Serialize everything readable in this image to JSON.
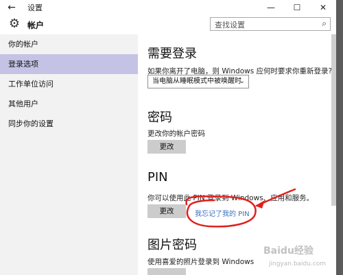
{
  "titlebar": {
    "back_icon": "←",
    "title": "设置",
    "minimize": "—",
    "maximize": "☐",
    "close": "✕"
  },
  "header": {
    "gear_icon": "⚙",
    "section": "帐户",
    "search_placeholder": "查找设置",
    "search_icon": "⌕"
  },
  "sidebar": {
    "items": [
      {
        "label": "你的帐户"
      },
      {
        "label": "登录选项"
      },
      {
        "label": "工作单位访问"
      },
      {
        "label": "其他用户"
      },
      {
        "label": "同步你的设置"
      }
    ],
    "selected_index": 1
  },
  "require_signin": {
    "heading": "需要登录",
    "description": "如果你离开了电脑，则 Windows 应何时要求你重新登录?",
    "dropdown_value": "当电脑从睡眠模式中被唤醒时",
    "dropdown_icon": "⌄"
  },
  "password": {
    "heading": "密码",
    "description": "更改你的帐户密码",
    "button": "更改"
  },
  "pin": {
    "heading": "PIN",
    "description": "你可以使用此 PIN 登录到 Windows、应用和服务。",
    "button": "更改",
    "link": "我忘记了我的 PIN"
  },
  "picture_password": {
    "heading": "图片密码",
    "description": "使用喜爱的照片登录到 Windows"
  },
  "watermark": {
    "logo": "Baidu经验",
    "url": "jingyan.baidu.com"
  },
  "colors": {
    "selected_bg": "#c4c3e6",
    "sidebar_bg": "#f2f2f2",
    "button_bg": "#cccccc",
    "link": "#3c6fc0",
    "annotation": "#e0201c"
  }
}
